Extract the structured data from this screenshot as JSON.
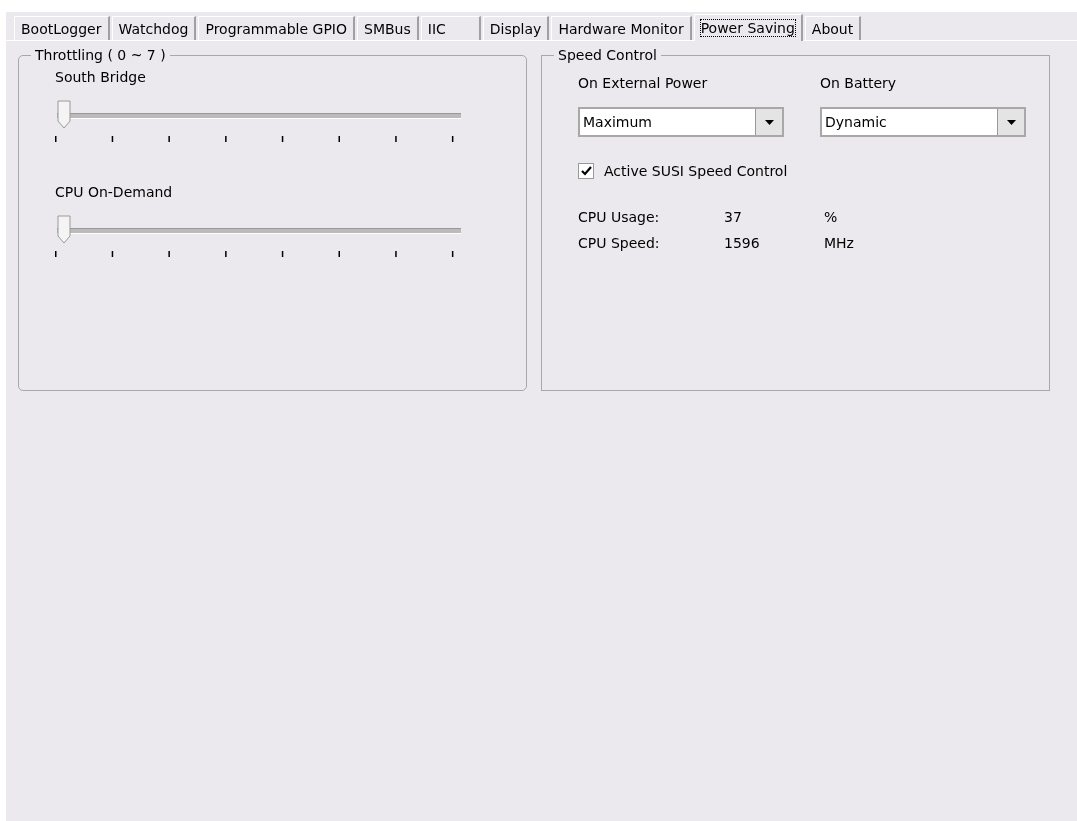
{
  "tabs": [
    {
      "label": "BootLogger",
      "selected": false
    },
    {
      "label": "Watchdog",
      "selected": false
    },
    {
      "label": "Programmable GPIO",
      "selected": false
    },
    {
      "label": "SMBus",
      "selected": false
    },
    {
      "label": "IIC",
      "selected": false
    },
    {
      "label": "Display",
      "selected": false
    },
    {
      "label": "Hardware Monitor",
      "selected": false
    },
    {
      "label": "Power Saving",
      "selected": true
    },
    {
      "label": "About",
      "selected": false
    }
  ],
  "throttling": {
    "title": "Throttling  ( 0 ~ 7 )",
    "sliders": [
      {
        "label": "South Bridge",
        "level": 0
      },
      {
        "label": "CPU On-Demand",
        "level": 0
      }
    ]
  },
  "speed_control": {
    "title": "Speed Control",
    "dropdowns": [
      {
        "label": "On External Power",
        "value": "Maximum"
      },
      {
        "label": "On Battery",
        "value": "Dynamic"
      }
    ],
    "checkbox": {
      "label": "Active SUSI Speed Control",
      "checked": true
    },
    "readings": [
      {
        "label": "CPU Usage:",
        "value": "37",
        "unit": "%"
      },
      {
        "label": "CPU Speed:",
        "value": "1596",
        "unit": "MHz"
      }
    ]
  }
}
